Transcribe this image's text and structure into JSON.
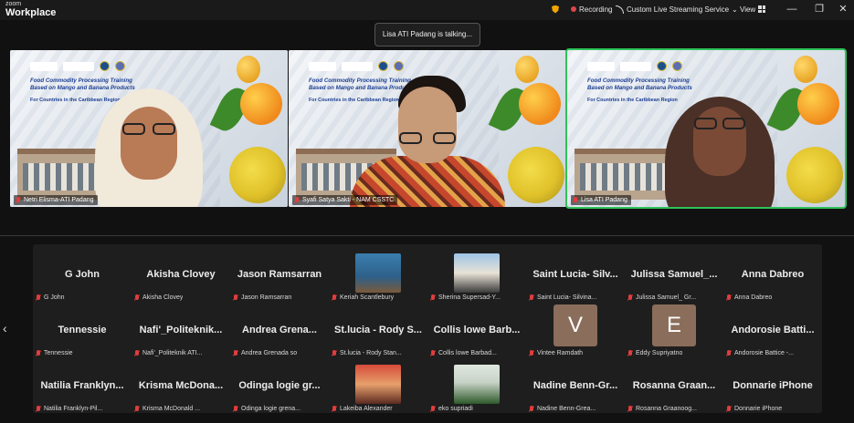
{
  "app": {
    "brand_top": "zoom",
    "brand_bottom": "Workplace",
    "recording_label": "Recording",
    "streaming_label": "Custom Live Streaming Service",
    "view_label": "View"
  },
  "talking_indicator": "Lisa ATI Padang is talking...",
  "slide": {
    "title_line1": "Food Commodity Processing Training",
    "title_line2": "Based on Mango and Banana Products",
    "subtitle": "For Countries in the Caribbean Region"
  },
  "speakers": [
    {
      "name": "Netri Elisma-ATI Padang"
    },
    {
      "name": "Syafi Satya Sakti - NAM CSSTC"
    },
    {
      "name": "Lisa ATI Padang"
    }
  ],
  "gallery": {
    "rows": [
      [
        {
          "big": "G John",
          "small": "G John"
        },
        {
          "big": "Akisha Clovey",
          "small": "Akisha Clovey"
        },
        {
          "big": "Jason Ramsarran",
          "small": "Jason Ramsarran"
        },
        {
          "photo": "p1",
          "small": "Keriah Scantlebury"
        },
        {
          "photo": "p2",
          "small": "Sherina Supersad-Y..."
        },
        {
          "big": "Saint Lucia- Silv...",
          "small": "Saint Lucia- Silvina..."
        },
        {
          "big": "Julissa Samuel_...",
          "small": "Julissa Samuel_ Gr..."
        },
        {
          "big": "Anna Dabreo",
          "small": "Anna Dabreo"
        }
      ],
      [
        {
          "big": "Tennessie",
          "small": "Tennessie"
        },
        {
          "big": "Nafi'_Politeknik...",
          "small": "Nafi'_Politeknik ATI..."
        },
        {
          "big": "Andrea Grena...",
          "small": "Andrea Grenada so"
        },
        {
          "big": "St.lucia - Rody S...",
          "small": "St.lucia - Rody Stan..."
        },
        {
          "big": "Collis lowe Barb...",
          "small": "Collis lowe Barbad..."
        },
        {
          "initial": "V",
          "small": "Vintee Ramdath"
        },
        {
          "initial": "E",
          "small": "Eddy Supriyatno"
        },
        {
          "big": "Andorosie Batti...",
          "small": "Andorosie Battice -..."
        }
      ],
      [
        {
          "big": "Natilia Franklyn...",
          "small": "Natilia Franklyn-Pil..."
        },
        {
          "big": "Krisma McDona...",
          "small": "Krisma McDonald ..."
        },
        {
          "big": "Odinga logie gr...",
          "small": "Odinga logie grena..."
        },
        {
          "photo": "p3",
          "small": "Lakeiba Alexander"
        },
        {
          "photo": "p4",
          "small": "eko supriadi"
        },
        {
          "big": "Nadine Benn-Gr...",
          "small": "Nadine Benn-Grea..."
        },
        {
          "big": "Rosanna Graan...",
          "small": "Rosanna Graanoog..."
        },
        {
          "big": "Donnarie iPhone",
          "small": "Donnarie iPhone"
        }
      ]
    ]
  },
  "colors": {
    "active_speaker_border": "#2fc25b",
    "muted_mic": "#e23c3c",
    "background": "#111111"
  }
}
